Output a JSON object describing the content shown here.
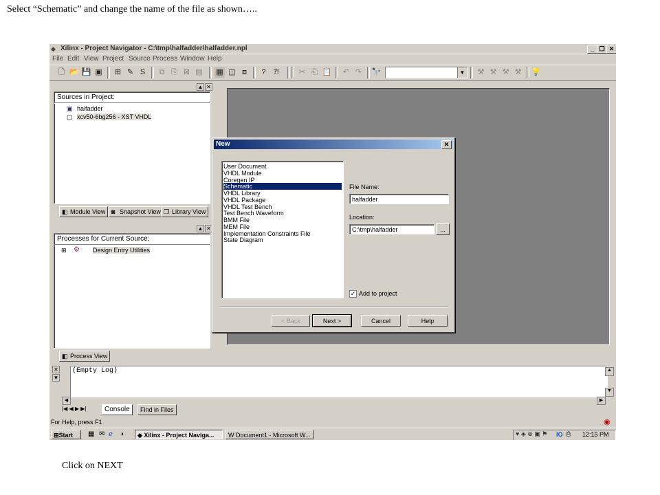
{
  "captions": {
    "top": "Select “Schematic” and change the name of the file as shown…..",
    "bottom": "Click on NEXT"
  },
  "window": {
    "title": "Xilinx - Project Navigator - C:\\tmp\\halfadder\\halfadder.npl",
    "menus": [
      "File",
      "Edit",
      "View",
      "Project",
      "Source",
      "Process",
      "Window",
      "Help"
    ]
  },
  "sources_panel": {
    "header": "Sources in Project:",
    "tree": [
      "halfadder",
      "xcv50-6bg256 - XST VHDL"
    ],
    "tabs": [
      "Module View",
      "Snapshot View",
      "Library View"
    ]
  },
  "processes_panel": {
    "header": "Processes for Current Source:",
    "tree": [
      "Design Entry Utilities"
    ],
    "tabs": [
      "Process View"
    ]
  },
  "dialog": {
    "title": "New",
    "close": "✕",
    "types": [
      "User Document",
      "VHDL Module",
      "Coregen IP",
      "Schematic",
      "VHDL Library",
      "VHDL Package",
      "VHDL Test Bench",
      "Test Bench Waveform",
      "BMM File",
      "MEM File",
      "Implementation Constraints File",
      "State Diagram"
    ],
    "selected_index": 3,
    "file_name_label": "File Name:",
    "file_name_value": "halfadder",
    "location_label": "Location:",
    "location_value": "C:\\tmp\\halfadder",
    "browse_label": "...",
    "add_to_project_label": "Add to project",
    "add_to_project_checked": true,
    "buttons": {
      "back": "< Back",
      "next": "Next >",
      "cancel": "Cancel",
      "help": "Help"
    }
  },
  "console": {
    "text": "(Empty Log)",
    "tabs": [
      "Console",
      "Find in Files"
    ]
  },
  "statusbar": {
    "text": "For Help, press F1"
  },
  "taskbar": {
    "start": "Start",
    "tasks": [
      "Xilinx - Project Naviga...",
      "Document1 - Microsoft W..."
    ],
    "tray_text": "IO",
    "clock": "12:15 PM"
  },
  "colors": {
    "selection": "#0a246a",
    "chrome": "#d4d0c8",
    "workarea": "#808080"
  }
}
